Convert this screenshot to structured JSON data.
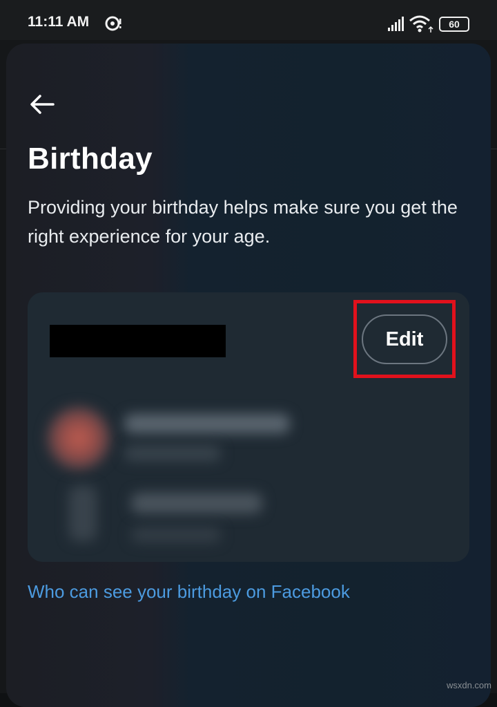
{
  "status_bar": {
    "time": "11:11 AM",
    "battery": "60"
  },
  "header": {
    "back_icon": "arrow-left-icon"
  },
  "main": {
    "title": "Birthday",
    "description": "Providing your birthday helps make sure you get the right experience for your age.",
    "card": {
      "edit_label": "Edit"
    },
    "link_text": "Who can see your birthday on Facebook"
  },
  "colors": {
    "link": "#4c9be0",
    "highlight": "#e1111c"
  },
  "watermark": "wsxdn.com"
}
